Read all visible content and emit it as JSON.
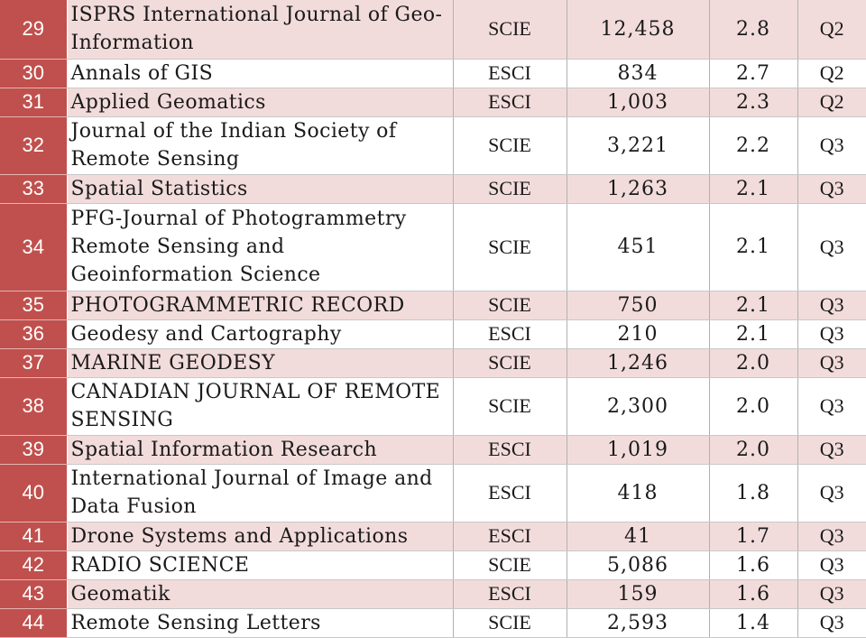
{
  "table": {
    "rows": [
      {
        "rank": "29",
        "name": "ISPRS International Journal of Geo-Information",
        "db": "SCIE",
        "citations": "12,458",
        "if": "2.8",
        "quartile": "Q2",
        "band": true,
        "h": 65
      },
      {
        "rank": "30",
        "name": "Annals of GIS",
        "db": "ESCI",
        "citations": "834",
        "if": "2.7",
        "quartile": "Q2",
        "band": false,
        "h": 32
      },
      {
        "rank": "31",
        "name": "Applied Geomatics",
        "db": "ESCI",
        "citations": "1,003",
        "if": "2.3",
        "quartile": "Q2",
        "band": true,
        "h": 32
      },
      {
        "rank": "32",
        "name": "Journal of the Indian Society of Remote Sensing",
        "db": "SCIE",
        "citations": "3,221",
        "if": "2.2",
        "quartile": "Q3",
        "band": false,
        "h": 64
      },
      {
        "rank": "33",
        "name": "Spatial Statistics",
        "db": "SCIE",
        "citations": "1,263",
        "if": "2.1",
        "quartile": "Q3",
        "band": true,
        "h": 32
      },
      {
        "rank": "34",
        "name": "PFG-Journal of Photogrammetry Remote Sensing and Geoinformation Science",
        "db": "SCIE",
        "citations": "451",
        "if": "2.1",
        "quartile": "Q3",
        "band": false,
        "h": 97
      },
      {
        "rank": "35",
        "name": "PHOTOGRAMMETRIC RECORD",
        "db": "SCIE",
        "citations": "750",
        "if": "2.1",
        "quartile": "Q3",
        "band": true,
        "h": 32
      },
      {
        "rank": "36",
        "name": "Geodesy and Cartography",
        "db": "ESCI",
        "citations": "210",
        "if": "2.1",
        "quartile": "Q3",
        "band": false,
        "h": 32
      },
      {
        "rank": "37",
        "name": "MARINE GEODESY",
        "db": "SCIE",
        "citations": "1,246",
        "if": "2.0",
        "quartile": "Q3",
        "band": true,
        "h": 31
      },
      {
        "rank": "38",
        "name": "CANADIAN JOURNAL OF REMOTE SENSING",
        "db": "SCIE",
        "citations": "2,300",
        "if": "2.0",
        "quartile": "Q3",
        "band": false,
        "h": 64
      },
      {
        "rank": "39",
        "name": "Spatial Information Research",
        "db": "ESCI",
        "citations": "1,019",
        "if": "2.0",
        "quartile": "Q3",
        "band": true,
        "h": 32
      },
      {
        "rank": "40",
        "name": "International Journal of Image and Data Fusion",
        "db": "ESCI",
        "citations": "418",
        "if": "1.8",
        "quartile": "Q3",
        "band": false,
        "h": 64
      },
      {
        "rank": "41",
        "name": "Drone Systems and Applications",
        "db": "ESCI",
        "citations": "41",
        "if": "1.7",
        "quartile": "Q3",
        "band": true,
        "h": 32
      },
      {
        "rank": "42",
        "name": "RADIO SCIENCE",
        "db": "SCIE",
        "citations": "5,086",
        "if": "1.6",
        "quartile": "Q3",
        "band": false,
        "h": 31
      },
      {
        "rank": "43",
        "name": "Geomatik",
        "db": "ESCI",
        "citations": "159",
        "if": "1.6",
        "quartile": "Q3",
        "band": true,
        "h": 32
      },
      {
        "rank": "44",
        "name": "Remote Sensing Letters",
        "db": "SCIE",
        "citations": "2,593",
        "if": "1.4",
        "quartile": "Q3",
        "band": false,
        "h": 32
      }
    ]
  },
  "colors": {
    "rank_bg": "#c0504d",
    "band_bg": "#f2dcdb",
    "plain_bg": "#ffffff"
  }
}
